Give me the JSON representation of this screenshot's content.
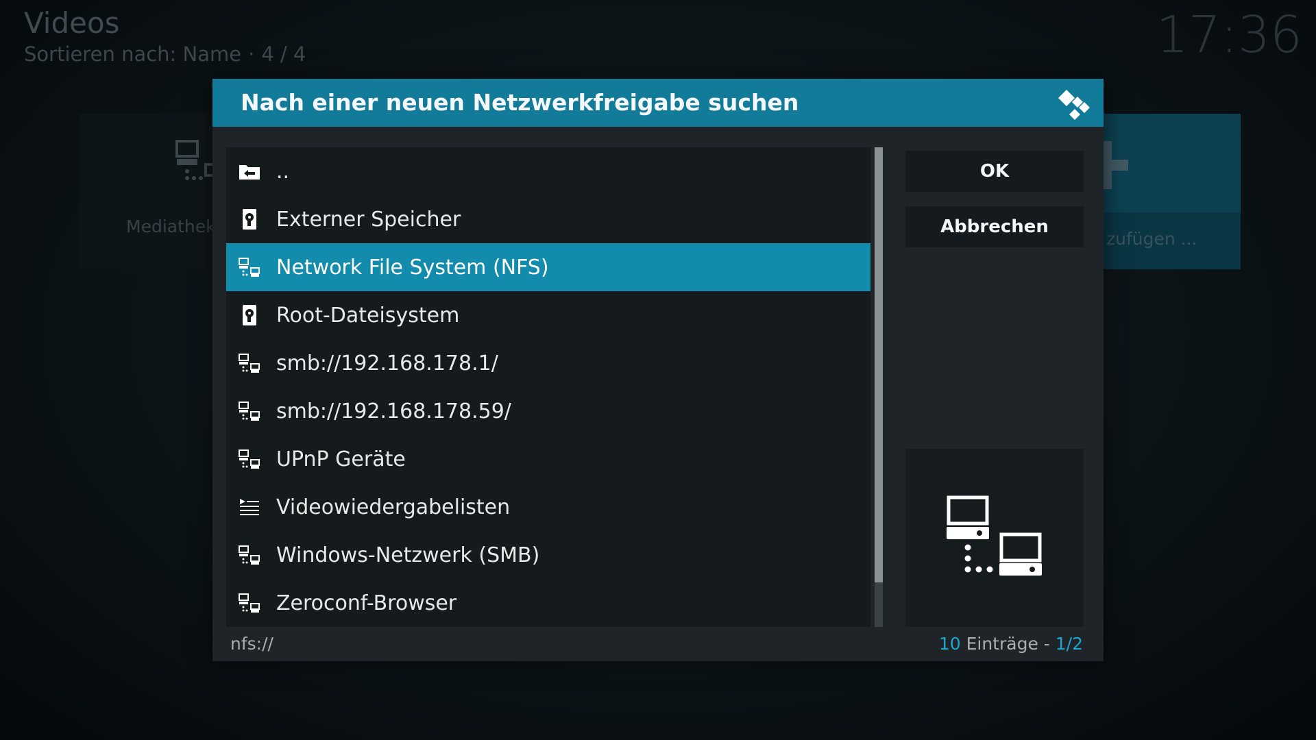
{
  "background": {
    "title": "Videos",
    "sort_label": "Sortieren nach: Name",
    "separator": "·",
    "position": "4 / 4",
    "clock": "17:36",
    "left_tile_label": "MediathekV",
    "right_tile_label": "zufügen ...",
    "right_tile_icon": "plus-icon"
  },
  "dialog": {
    "title": "Nach einer neuen Netzwerkfreigabe suchen",
    "logo_icon": "kodi-logo-icon",
    "items": [
      {
        "label": "..",
        "icon": "folder-back-icon"
      },
      {
        "label": "Externer Speicher",
        "icon": "harddisk-icon"
      },
      {
        "label": "Network File System (NFS)",
        "icon": "network-icon",
        "selected": true
      },
      {
        "label": "Root-Dateisystem",
        "icon": "harddisk-icon"
      },
      {
        "label": "smb://192.168.178.1/",
        "icon": "network-icon"
      },
      {
        "label": "smb://192.168.178.59/",
        "icon": "network-icon"
      },
      {
        "label": "UPnP Geräte",
        "icon": "network-icon"
      },
      {
        "label": "Videowiedergabelisten",
        "icon": "playlist-icon"
      },
      {
        "label": "Windows-Netzwerk (SMB)",
        "icon": "network-icon"
      },
      {
        "label": "Zeroconf-Browser",
        "icon": "network-icon"
      }
    ],
    "ok_label": "OK",
    "cancel_label": "Abbrechen",
    "preview_icon": "network-large-icon",
    "path": "nfs://",
    "count_number": "10",
    "count_text": " Einträge - ",
    "page": "1/2"
  },
  "colors": {
    "accent": "#128bac",
    "header": "#137b9a",
    "count_accent": "#1ca5cf"
  }
}
